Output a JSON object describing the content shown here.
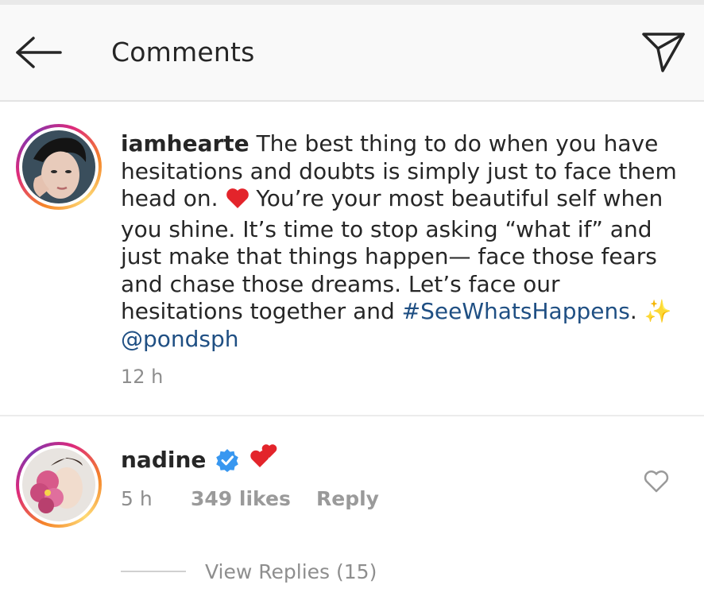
{
  "header": {
    "title": "Comments",
    "back_icon": "arrow-left-icon",
    "share_icon": "paper-plane-icon"
  },
  "post": {
    "username": "iamhearte",
    "caption_part1": "The best thing to do when you have hesitations and doubts is simply just to face them head on.",
    "caption_part2": "You’re your most beautiful self when you shine. It’s time to stop asking “what if” and just make that things happen— face those fears and chase those dreams. Let’s face our hesitations together and",
    "hashtag": "#SeeWhatsHappens",
    "mention": "@pondsph",
    "timestamp": "12 h"
  },
  "comment": {
    "username": "nadine",
    "verified": true,
    "emoji": "💕",
    "time": "5 h",
    "likes": "349 likes",
    "reply_label": "Reply",
    "view_replies": "View Replies (15)"
  },
  "colors": {
    "link": "#1f4f83",
    "muted": "#8e8e8e",
    "verified": "#3897f0",
    "heart": "#ed1c24"
  }
}
